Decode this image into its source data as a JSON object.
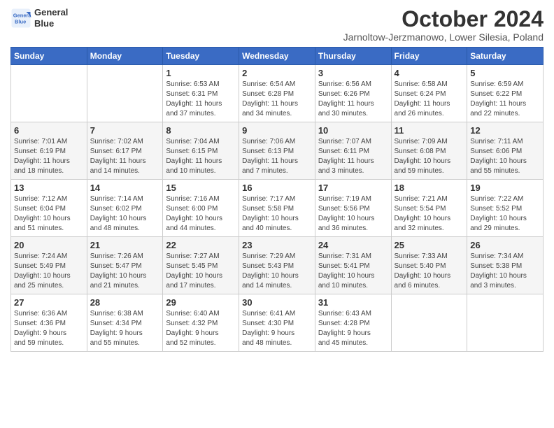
{
  "header": {
    "logo_line1": "General",
    "logo_line2": "Blue",
    "month_title": "October 2024",
    "location": "Jarnoltow-Jerzmanowo, Lower Silesia, Poland"
  },
  "weekdays": [
    "Sunday",
    "Monday",
    "Tuesday",
    "Wednesday",
    "Thursday",
    "Friday",
    "Saturday"
  ],
  "weeks": [
    [
      {
        "day": "",
        "info": ""
      },
      {
        "day": "",
        "info": ""
      },
      {
        "day": "1",
        "info": "Sunrise: 6:53 AM\nSunset: 6:31 PM\nDaylight: 11 hours\nand 37 minutes."
      },
      {
        "day": "2",
        "info": "Sunrise: 6:54 AM\nSunset: 6:28 PM\nDaylight: 11 hours\nand 34 minutes."
      },
      {
        "day": "3",
        "info": "Sunrise: 6:56 AM\nSunset: 6:26 PM\nDaylight: 11 hours\nand 30 minutes."
      },
      {
        "day": "4",
        "info": "Sunrise: 6:58 AM\nSunset: 6:24 PM\nDaylight: 11 hours\nand 26 minutes."
      },
      {
        "day": "5",
        "info": "Sunrise: 6:59 AM\nSunset: 6:22 PM\nDaylight: 11 hours\nand 22 minutes."
      }
    ],
    [
      {
        "day": "6",
        "info": "Sunrise: 7:01 AM\nSunset: 6:19 PM\nDaylight: 11 hours\nand 18 minutes."
      },
      {
        "day": "7",
        "info": "Sunrise: 7:02 AM\nSunset: 6:17 PM\nDaylight: 11 hours\nand 14 minutes."
      },
      {
        "day": "8",
        "info": "Sunrise: 7:04 AM\nSunset: 6:15 PM\nDaylight: 11 hours\nand 10 minutes."
      },
      {
        "day": "9",
        "info": "Sunrise: 7:06 AM\nSunset: 6:13 PM\nDaylight: 11 hours\nand 7 minutes."
      },
      {
        "day": "10",
        "info": "Sunrise: 7:07 AM\nSunset: 6:11 PM\nDaylight: 11 hours\nand 3 minutes."
      },
      {
        "day": "11",
        "info": "Sunrise: 7:09 AM\nSunset: 6:08 PM\nDaylight: 10 hours\nand 59 minutes."
      },
      {
        "day": "12",
        "info": "Sunrise: 7:11 AM\nSunset: 6:06 PM\nDaylight: 10 hours\nand 55 minutes."
      }
    ],
    [
      {
        "day": "13",
        "info": "Sunrise: 7:12 AM\nSunset: 6:04 PM\nDaylight: 10 hours\nand 51 minutes."
      },
      {
        "day": "14",
        "info": "Sunrise: 7:14 AM\nSunset: 6:02 PM\nDaylight: 10 hours\nand 48 minutes."
      },
      {
        "day": "15",
        "info": "Sunrise: 7:16 AM\nSunset: 6:00 PM\nDaylight: 10 hours\nand 44 minutes."
      },
      {
        "day": "16",
        "info": "Sunrise: 7:17 AM\nSunset: 5:58 PM\nDaylight: 10 hours\nand 40 minutes."
      },
      {
        "day": "17",
        "info": "Sunrise: 7:19 AM\nSunset: 5:56 PM\nDaylight: 10 hours\nand 36 minutes."
      },
      {
        "day": "18",
        "info": "Sunrise: 7:21 AM\nSunset: 5:54 PM\nDaylight: 10 hours\nand 32 minutes."
      },
      {
        "day": "19",
        "info": "Sunrise: 7:22 AM\nSunset: 5:52 PM\nDaylight: 10 hours\nand 29 minutes."
      }
    ],
    [
      {
        "day": "20",
        "info": "Sunrise: 7:24 AM\nSunset: 5:49 PM\nDaylight: 10 hours\nand 25 minutes."
      },
      {
        "day": "21",
        "info": "Sunrise: 7:26 AM\nSunset: 5:47 PM\nDaylight: 10 hours\nand 21 minutes."
      },
      {
        "day": "22",
        "info": "Sunrise: 7:27 AM\nSunset: 5:45 PM\nDaylight: 10 hours\nand 17 minutes."
      },
      {
        "day": "23",
        "info": "Sunrise: 7:29 AM\nSunset: 5:43 PM\nDaylight: 10 hours\nand 14 minutes."
      },
      {
        "day": "24",
        "info": "Sunrise: 7:31 AM\nSunset: 5:41 PM\nDaylight: 10 hours\nand 10 minutes."
      },
      {
        "day": "25",
        "info": "Sunrise: 7:33 AM\nSunset: 5:40 PM\nDaylight: 10 hours\nand 6 minutes."
      },
      {
        "day": "26",
        "info": "Sunrise: 7:34 AM\nSunset: 5:38 PM\nDaylight: 10 hours\nand 3 minutes."
      }
    ],
    [
      {
        "day": "27",
        "info": "Sunrise: 6:36 AM\nSunset: 4:36 PM\nDaylight: 9 hours\nand 59 minutes."
      },
      {
        "day": "28",
        "info": "Sunrise: 6:38 AM\nSunset: 4:34 PM\nDaylight: 9 hours\nand 55 minutes."
      },
      {
        "day": "29",
        "info": "Sunrise: 6:40 AM\nSunset: 4:32 PM\nDaylight: 9 hours\nand 52 minutes."
      },
      {
        "day": "30",
        "info": "Sunrise: 6:41 AM\nSunset: 4:30 PM\nDaylight: 9 hours\nand 48 minutes."
      },
      {
        "day": "31",
        "info": "Sunrise: 6:43 AM\nSunset: 4:28 PM\nDaylight: 9 hours\nand 45 minutes."
      },
      {
        "day": "",
        "info": ""
      },
      {
        "day": "",
        "info": ""
      }
    ]
  ]
}
